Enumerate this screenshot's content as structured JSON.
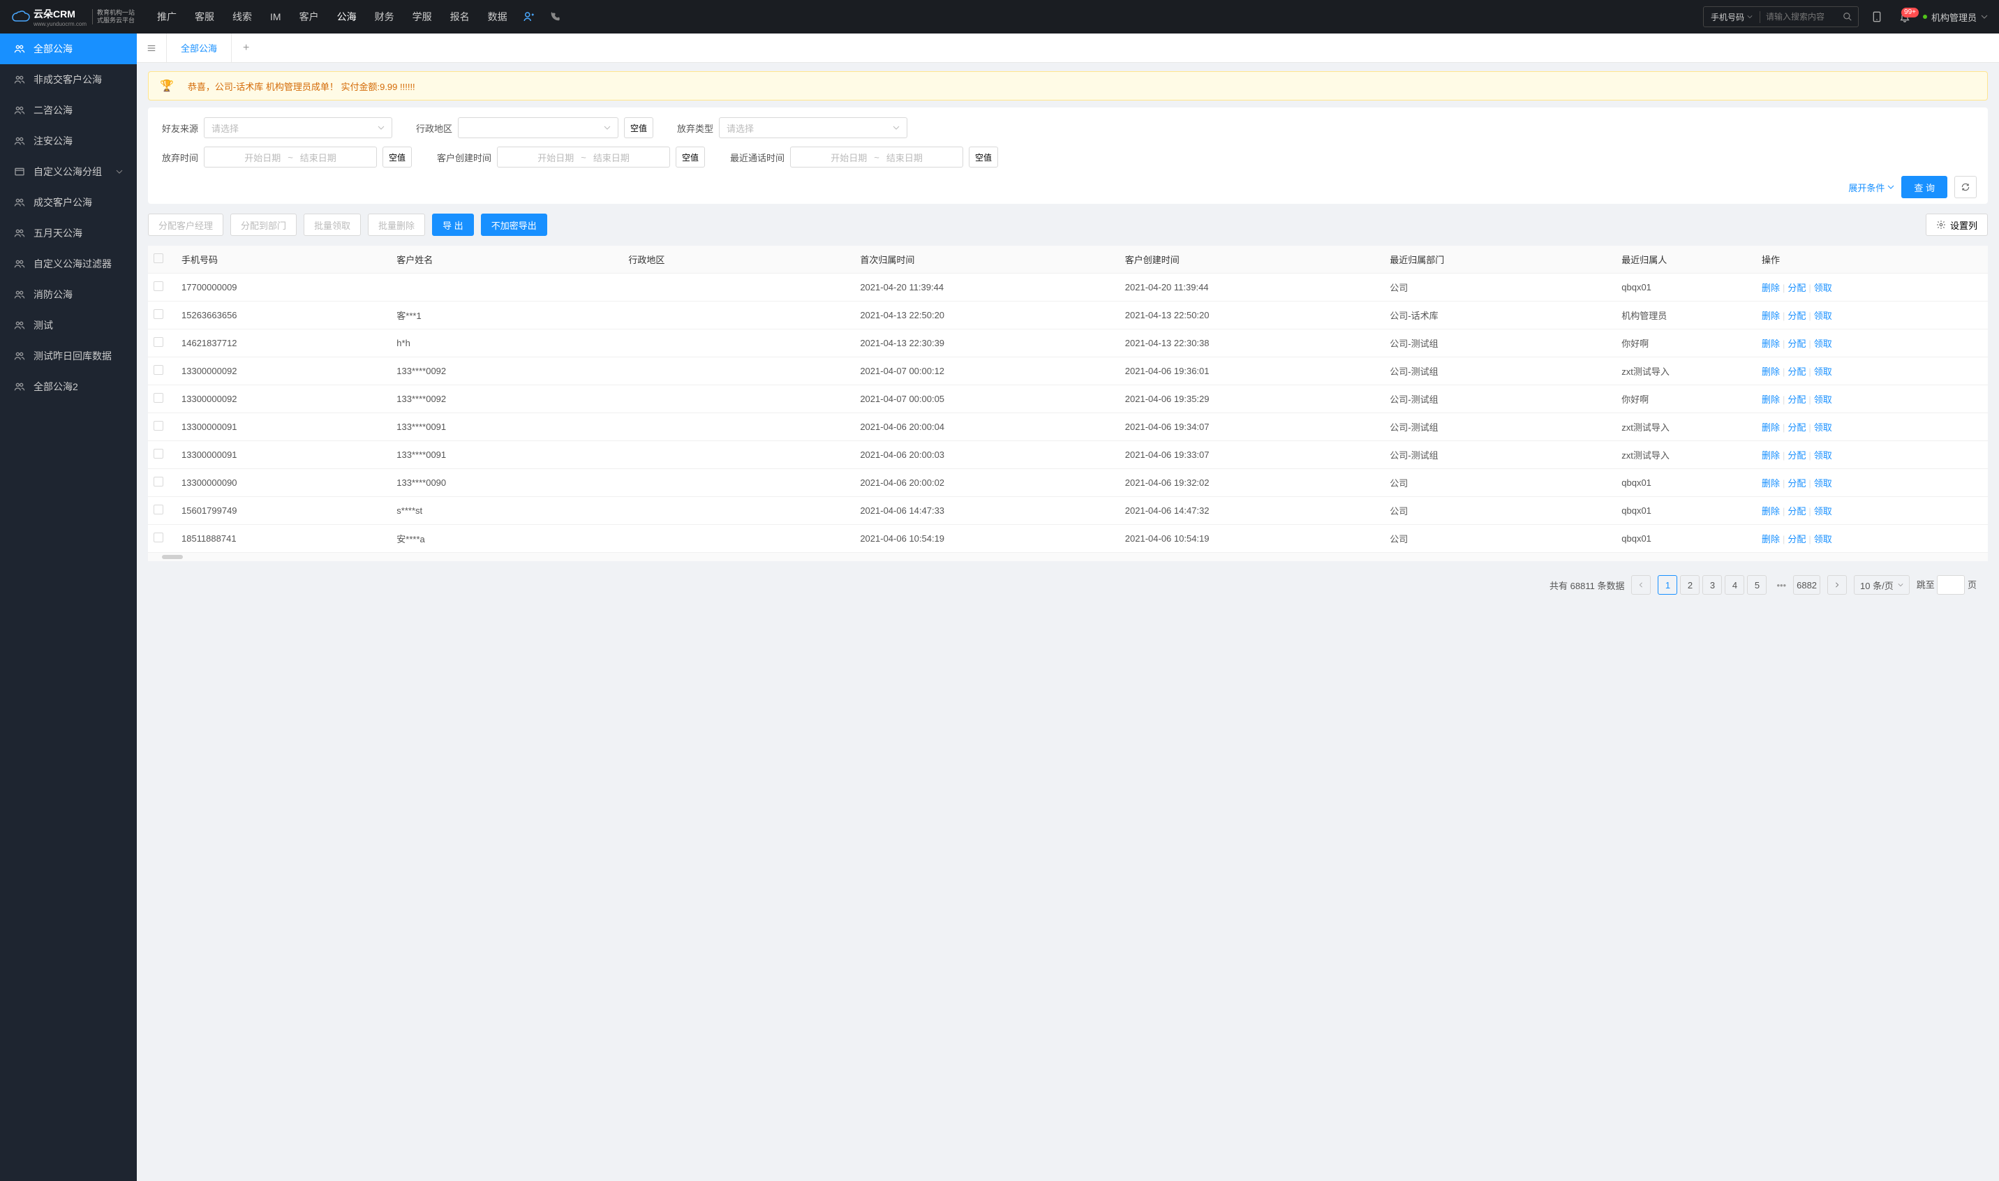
{
  "header": {
    "logo": {
      "brand": "云朵CRM",
      "url": "www.yunduocrm.com",
      "tagline1": "教育机构一站",
      "tagline2": "式服务云平台"
    },
    "nav": [
      "推广",
      "客服",
      "线索",
      "IM",
      "客户",
      "公海",
      "财务",
      "学服",
      "报名",
      "数据"
    ],
    "nav_active_index": 5,
    "search_type": "手机号码",
    "search_placeholder": "请输入搜索内容",
    "badge": "99+",
    "admin": "机构管理员"
  },
  "sidebar": [
    {
      "label": "全部公海",
      "icon": "users",
      "active": true
    },
    {
      "label": "非成交客户公海",
      "icon": "users",
      "active": false
    },
    {
      "label": "二咨公海",
      "icon": "users",
      "active": false
    },
    {
      "label": "注安公海",
      "icon": "users",
      "active": false
    },
    {
      "label": "自定义公海分组",
      "icon": "folder",
      "active": false,
      "expandable": true
    },
    {
      "label": "成交客户公海",
      "icon": "users",
      "active": false
    },
    {
      "label": "五月天公海",
      "icon": "users",
      "active": false
    },
    {
      "label": "自定义公海过滤器",
      "icon": "users",
      "active": false
    },
    {
      "label": "消防公海",
      "icon": "users",
      "active": false
    },
    {
      "label": "测试",
      "icon": "users",
      "active": false
    },
    {
      "label": "测试昨日回库数据",
      "icon": "users",
      "active": false
    },
    {
      "label": "全部公海2",
      "icon": "users",
      "active": false
    }
  ],
  "tabs": {
    "active": "全部公海"
  },
  "banner": "恭喜，公司-话术库   机构管理员成单！   实付金额:9.99 !!!!!!",
  "filters": {
    "source_label": "好友来源",
    "source_ph": "请选择",
    "region_label": "行政地区",
    "null_btn": "空值",
    "abandon_type_label": "放弃类型",
    "abandon_type_ph": "请选择",
    "abandon_time_label": "放弃时间",
    "start_ph": "开始日期",
    "end_ph": "结束日期",
    "create_time_label": "客户创建时间",
    "last_call_label": "最近通话时间",
    "expand": "展开条件",
    "query": "查 询"
  },
  "toolbar": {
    "assign_manager": "分配客户经理",
    "assign_dept": "分配到部门",
    "batch_claim": "批量领取",
    "batch_delete": "批量删除",
    "export": "导 出",
    "export_plain": "不加密导出",
    "columns": "设置列"
  },
  "table": {
    "columns": [
      "手机号码",
      "客户姓名",
      "行政地区",
      "首次归属时间",
      "客户创建时间",
      "最近归属部门",
      "最近归属人",
      "操作"
    ],
    "actions": {
      "delete": "删除",
      "assign": "分配",
      "claim": "领取"
    },
    "rows": [
      {
        "phone": "17700000009",
        "name": "",
        "region": "",
        "first": "2021-04-20 11:39:44",
        "created": "2021-04-20 11:39:44",
        "dept": "公司",
        "owner": "qbqx01"
      },
      {
        "phone": "15263663656",
        "name": "客***1",
        "region": "",
        "first": "2021-04-13 22:50:20",
        "created": "2021-04-13 22:50:20",
        "dept": "公司-话术库",
        "owner": "机构管理员"
      },
      {
        "phone": "14621837712",
        "name": "h*h",
        "region": "",
        "first": "2021-04-13 22:30:39",
        "created": "2021-04-13 22:30:38",
        "dept": "公司-测试组",
        "owner": "你好啊"
      },
      {
        "phone": "13300000092",
        "name": "133****0092",
        "region": "",
        "first": "2021-04-07 00:00:12",
        "created": "2021-04-06 19:36:01",
        "dept": "公司-测试组",
        "owner": "zxt测试导入"
      },
      {
        "phone": "13300000092",
        "name": "133****0092",
        "region": "",
        "first": "2021-04-07 00:00:05",
        "created": "2021-04-06 19:35:29",
        "dept": "公司-测试组",
        "owner": "你好啊"
      },
      {
        "phone": "13300000091",
        "name": "133****0091",
        "region": "",
        "first": "2021-04-06 20:00:04",
        "created": "2021-04-06 19:34:07",
        "dept": "公司-测试组",
        "owner": "zxt测试导入"
      },
      {
        "phone": "13300000091",
        "name": "133****0091",
        "region": "",
        "first": "2021-04-06 20:00:03",
        "created": "2021-04-06 19:33:07",
        "dept": "公司-测试组",
        "owner": "zxt测试导入"
      },
      {
        "phone": "13300000090",
        "name": "133****0090",
        "region": "",
        "first": "2021-04-06 20:00:02",
        "created": "2021-04-06 19:32:02",
        "dept": "公司",
        "owner": "qbqx01"
      },
      {
        "phone": "15601799749",
        "name": "s****st",
        "region": "",
        "first": "2021-04-06 14:47:33",
        "created": "2021-04-06 14:47:32",
        "dept": "公司",
        "owner": "qbqx01"
      },
      {
        "phone": "18511888741",
        "name": "安****a",
        "region": "",
        "first": "2021-04-06 10:54:19",
        "created": "2021-04-06 10:54:19",
        "dept": "公司",
        "owner": "qbqx01"
      }
    ]
  },
  "pagination": {
    "total_prefix": "共有 ",
    "total": "68811",
    "total_suffix": " 条数据",
    "pages": [
      "1",
      "2",
      "3",
      "4",
      "5"
    ],
    "last": "6882",
    "size": "10 条/页",
    "jump_label": "跳至",
    "page_suffix": "页"
  }
}
